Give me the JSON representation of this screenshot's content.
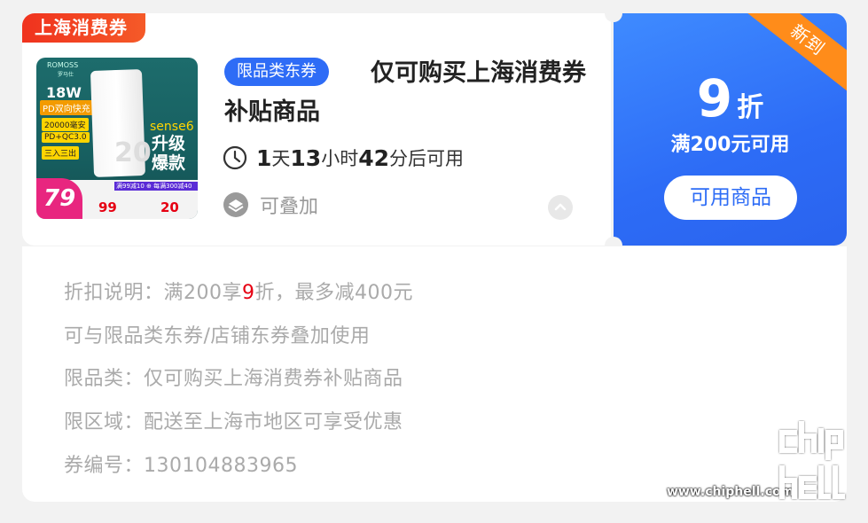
{
  "coupon": {
    "scope_tag": "上海消费券",
    "product_image": {
      "brand": "ROMOSS",
      "brand_sub": "罗马仕",
      "watt": "18W",
      "pd": "PD双向快充",
      "capacity": "20000毫安",
      "qc": "PD+QC3.0",
      "combo": "三入三出",
      "model": "sense6",
      "upgrade": "升级爆款",
      "device_number": "20",
      "promo_strip": "满99减10 ⊕ 每满300减40",
      "badge_price": "79",
      "price_1": "99",
      "price_2": "20"
    },
    "type_tag": "限品类东券",
    "title": "仅可购买上海消费券补贴商品",
    "countdown": {
      "days": "1",
      "days_unit": "天",
      "hours": "13",
      "hours_unit": "小时",
      "minutes": "42",
      "minutes_suffix": "分后可用"
    },
    "stackable_label": "可叠加",
    "ribbon": "新到",
    "discount_value": "9",
    "discount_unit": "折",
    "threshold": "满200元可用",
    "goods_button": "可用商品"
  },
  "details": {
    "discount_note_prefix": "折扣说明：满200享",
    "discount_note_highlight": "9",
    "discount_note_suffix": "折，最多减400元",
    "stack_note": "可与限品类东券/店铺东券叠加使用",
    "category_note": "限品类：仅可购买上海消费券补贴商品",
    "region_note": "限区域：配送至上海市地区可享受优惠",
    "coupon_id": "券编号：130104883965"
  },
  "watermark": {
    "url": "www.chiphell.com"
  },
  "colors": {
    "accent_blue": "#2d6cf6",
    "scope_red": "#f0321e",
    "ribbon_orange": "#ff8c1a",
    "highlight_red": "#e60012"
  }
}
